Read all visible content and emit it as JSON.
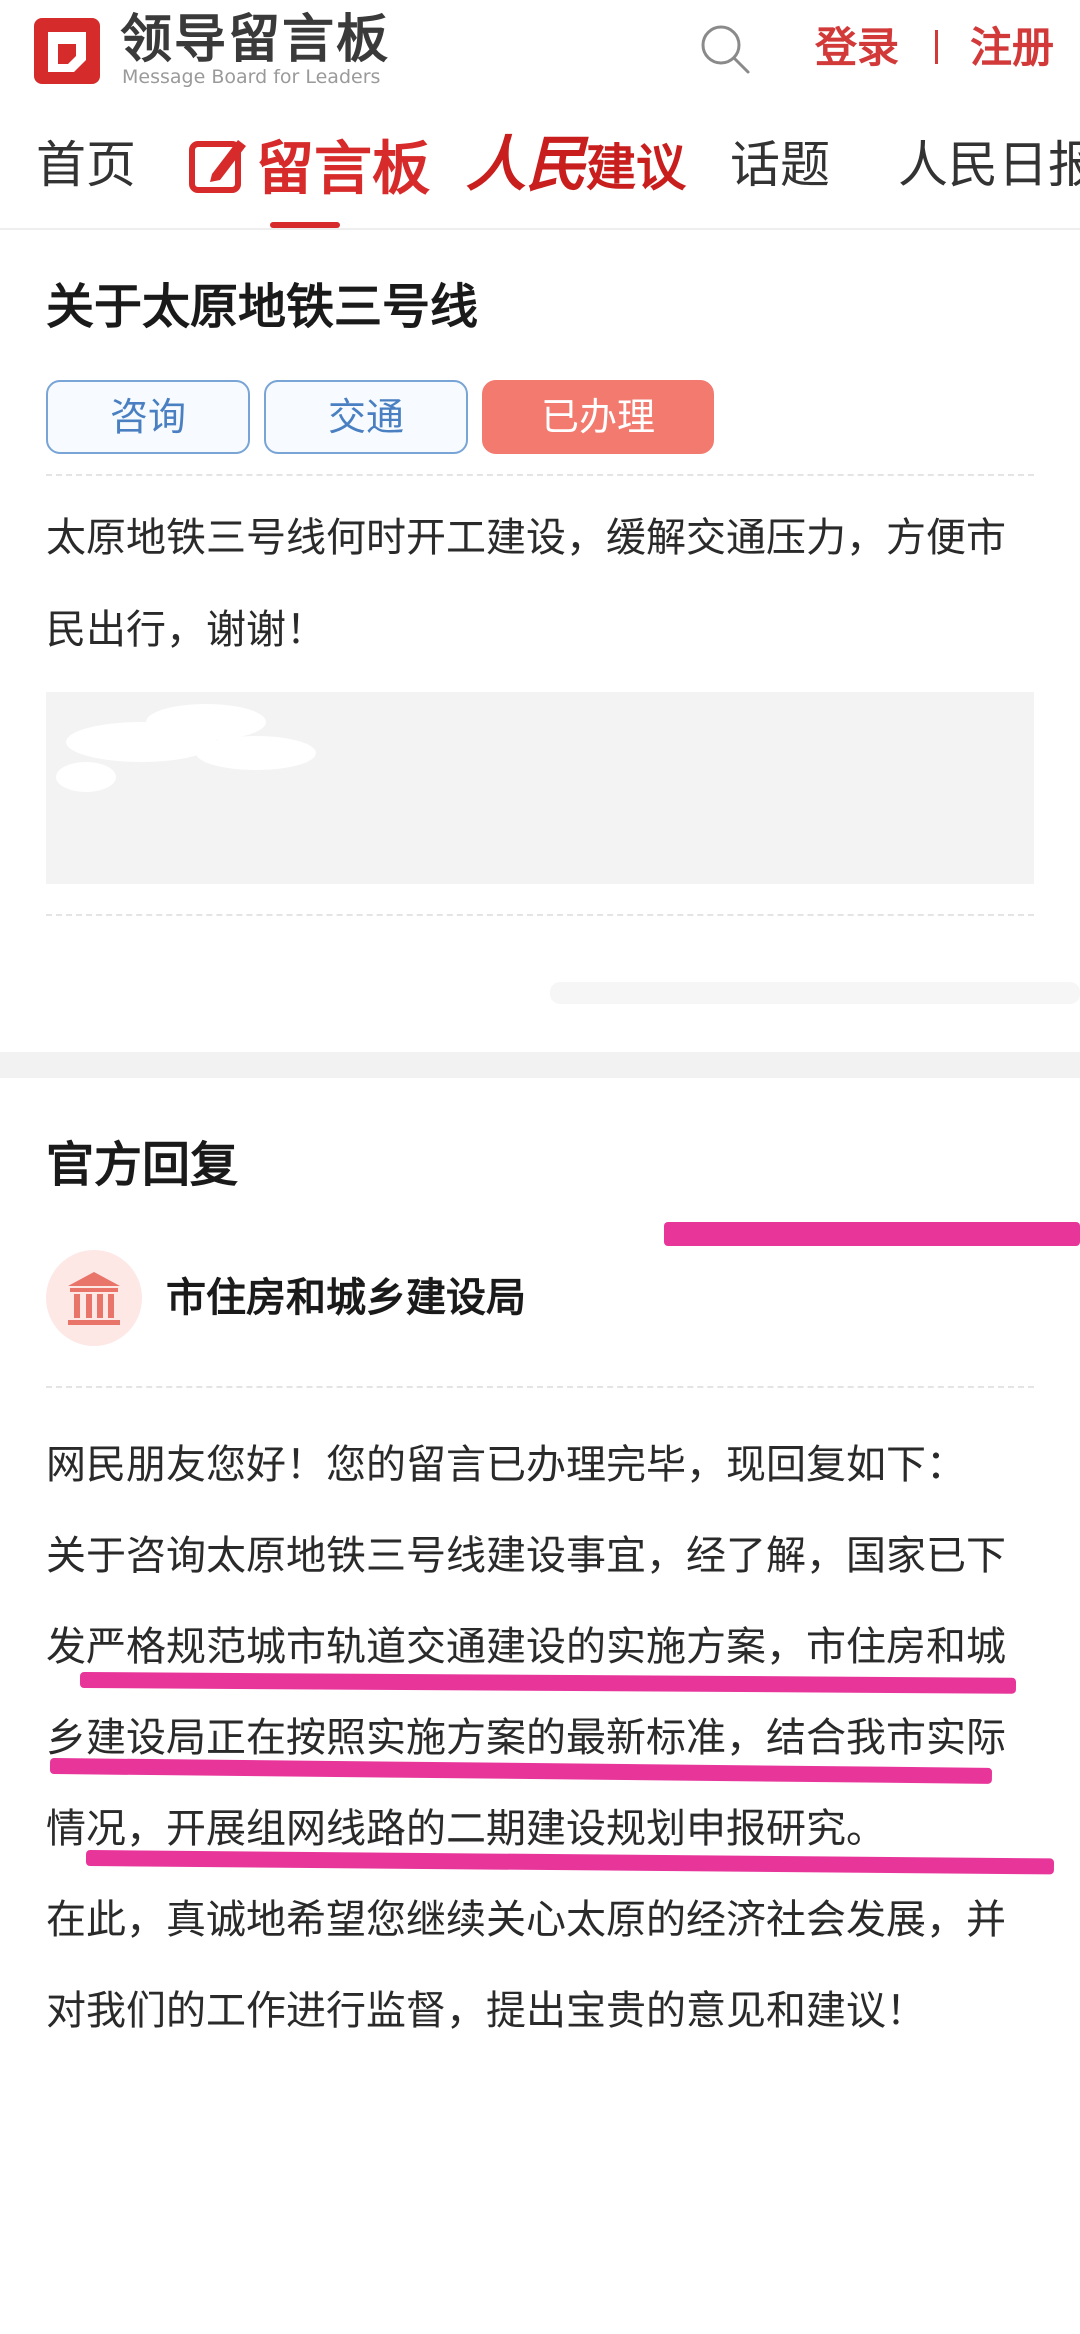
{
  "header": {
    "logo_title": "领导留言板",
    "logo_subtitle": "Message Board for Leaders",
    "login": "登录",
    "register": "注册",
    "brand_color": "#d23a3a"
  },
  "nav": {
    "items": [
      {
        "label": "首页"
      },
      {
        "label": "留言板",
        "active": true
      },
      {
        "label_part1": "人民",
        "label_part2": "建议"
      },
      {
        "label": "话题"
      },
      {
        "label": "人民日报"
      }
    ]
  },
  "question": {
    "title": "关于太原地铁三号线",
    "tags": [
      {
        "label": "咨询",
        "style": "outline-blue"
      },
      {
        "label": "交通",
        "style": "outline-blue"
      },
      {
        "label": "已办理",
        "style": "filled-red",
        "color": "#f37a6e"
      }
    ],
    "body": "太原地铁三号线何时开工建设，缓解交通压力，方便市民出行，谢谢！"
  },
  "reply": {
    "heading": "官方回复",
    "org_icon": "government-building-icon",
    "org_name": "市住房和城乡建设局",
    "paragraphs": [
      "网民朋友您好！您的留言已办理完毕，现回复如下：",
      "关于咨询太原地铁三号线建设事宜，经了解，国家已下发严格规范城市轨道交通建设的实施方案，市住房和城乡建设局正在按照实施方案的最新标准，结合我市实际情况，开展组网线路的二期建设规划申报研究。",
      "在此，真诚地希望您继续关心太原的经济社会发展，并对我们的工作进行监督，提出宝贵的意见和建议！"
    ],
    "highlight_color": "#e8359a"
  }
}
